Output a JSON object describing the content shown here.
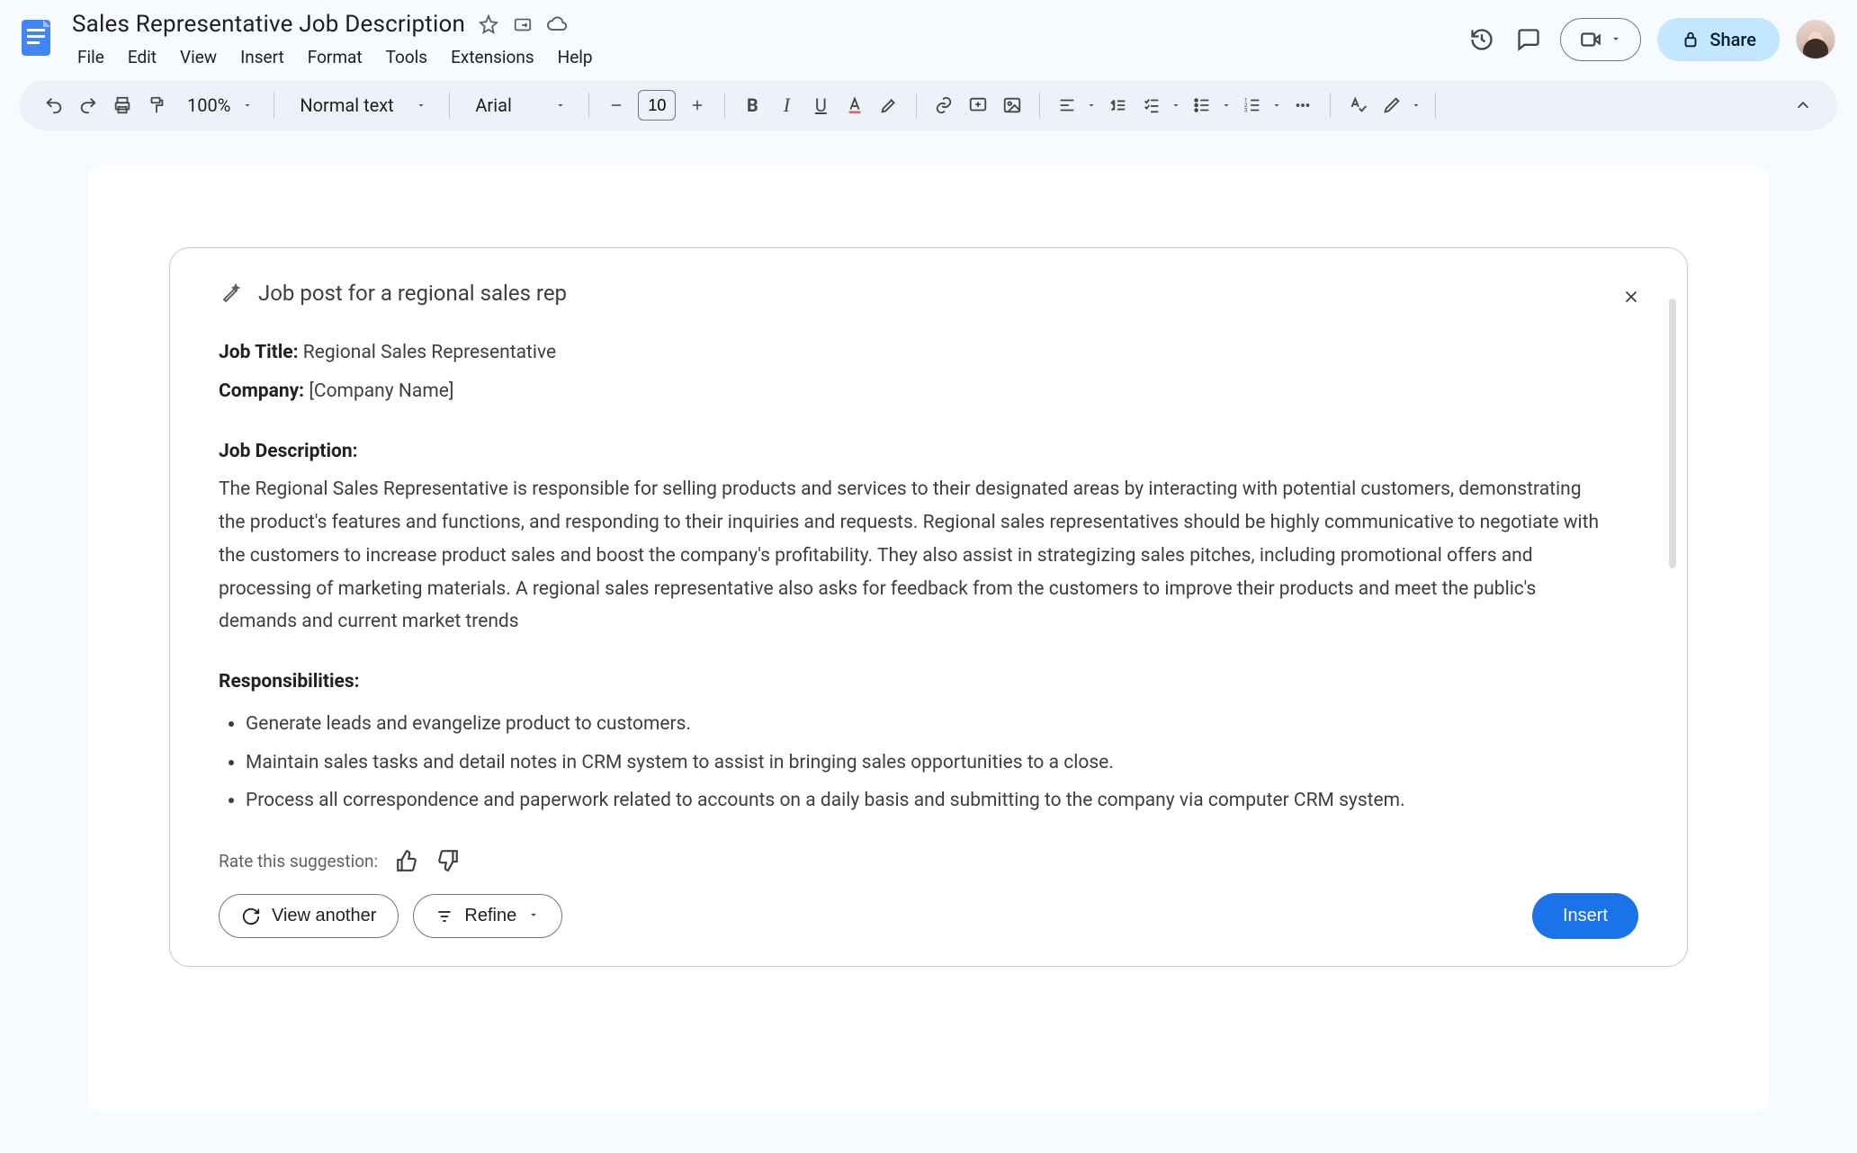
{
  "header": {
    "doc_title": "Sales Representative Job Description",
    "star_icon": "star-icon",
    "move_icon": "move-icon",
    "cloud_icon": "cloud-status-icon",
    "menus": [
      "File",
      "Edit",
      "View",
      "Insert",
      "Format",
      "Tools",
      "Extensions",
      "Help"
    ],
    "share_label": "Share"
  },
  "toolbar": {
    "zoom": "100%",
    "style": "Normal text",
    "font": "Arial",
    "font_size": "10"
  },
  "suggestion": {
    "prompt_title": "Job post for a regional sales rep",
    "job_title_label": "Job Title:",
    "job_title_value": "Regional Sales Representative",
    "company_label": "Company:",
    "company_value": "[Company Name]",
    "job_desc_label": "Job Description:",
    "job_desc_body": "The Regional Sales Representative is responsible for selling products and services to their designated areas by interacting with potential customers, demonstrating the product's features and functions, and responding to their inquiries and requests. Regional sales representatives should be highly communicative to negotiate with the customers to increase product sales and boost the company's profitability. They also assist in strategizing sales pitches, including promotional offers and processing of marketing materials. A regional sales representative also asks for feedback from the customers to improve their products and meet the public's demands and current market trends",
    "responsibilities_label": "Responsibilities:",
    "responsibilities": [
      "Generate leads and evangelize product to customers.",
      "Maintain sales tasks and detail notes in CRM system to assist in bringing sales opportunities to a close.",
      "Process all correspondence and paperwork related to accounts on a daily basis and submitting to the company via computer CRM system."
    ],
    "rate_label": "Rate this suggestion:",
    "view_another_label": "View another",
    "refine_label": "Refine",
    "insert_label": "Insert"
  }
}
